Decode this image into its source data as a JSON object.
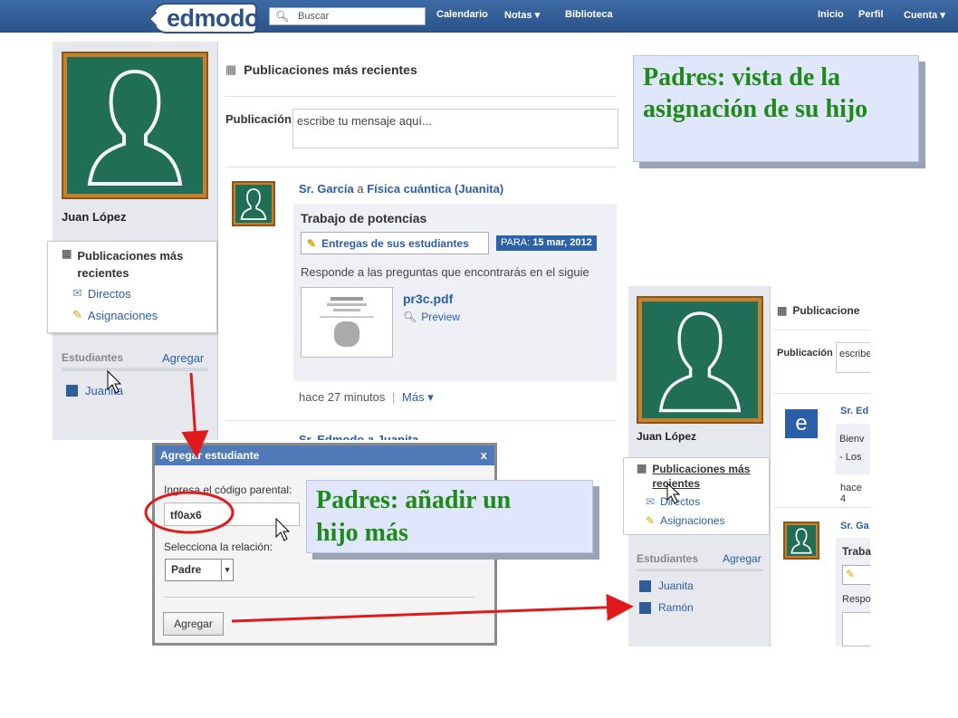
{
  "topbar": {
    "logo": "edmodo",
    "search_placeholder": "Buscar",
    "nav_calendar": "Calendario",
    "nav_notes": "Notas",
    "nav_library": "Biblioteca",
    "nav_home": "Inicio",
    "nav_profile": "Perfil",
    "nav_account": "Cuenta"
  },
  "left": {
    "user_name": "Juan López",
    "menu_recent_1": "Publicaciones más",
    "menu_recent_2": "recientes",
    "menu_direct": "Directos",
    "menu_assign": "Asignaciones",
    "students_label": "Estudiantes",
    "add_label": "Agregar",
    "student_1": "Juanita"
  },
  "feed": {
    "title": "Publicaciones más recientes",
    "post_label": "Publicación",
    "post_placeholder": "escribe tu mensaje aquí...",
    "author": "Sr. García",
    "connector": "a",
    "target": "Física cuántica (Juanita)",
    "assignment_title": "Trabajo de potencias",
    "submissions_btn": "Entregas de sus estudiantes",
    "due_label": "PARA:",
    "due_date": "15 mar, 2012",
    "body": "Responde a las preguntas que encontrarás en el siguie",
    "file_name": "pr3c.pdf",
    "preview": "Preview",
    "time_ago": "hace 27 minutos",
    "sep": "|",
    "more": "Más",
    "next_author": "Sr. Edmodo a Juanita"
  },
  "callout_top": {
    "line1": "Padres: vista de la",
    "line2": "asignación de su hijo"
  },
  "callout_mid": {
    "line1": "Padres: añadir un",
    "line2": "hijo más"
  },
  "dialog": {
    "title": "Agregar estudiante",
    "close": "x",
    "code_label": "Ingresa el código parental:",
    "code_value": "tf0ax6",
    "relation_label": "Selecciona la relación:",
    "relation_value": "Padre",
    "submit": "Agregar"
  },
  "right": {
    "feed_title": "Publicacione",
    "post_label": "Publicación",
    "post_placeholder": "escribe",
    "user_name": "Juan López",
    "menu_recent_1": "Publicaciones más",
    "menu_recent_2": "recientes",
    "menu_direct": "Directos",
    "menu_assign": "Asignaciones",
    "students_label": "Estudiantes",
    "add_label": "Agregar",
    "student_1": "Juanita",
    "student_2": "Ramón",
    "post1_author": "Sr. Ed",
    "post1_line1": "Bienv",
    "post1_line2": "- Los",
    "post1_time": "hace 4",
    "post2_author": "Sr. Ga",
    "post2_title": "Traba",
    "post2_body": "Respo",
    "edmodo_e": "e"
  },
  "colors": {
    "topbar": "#2c5289",
    "link": "#2b5ea8",
    "callout_text": "#1e8a17",
    "arrow": "#e01a1a",
    "board": "#1f6e55",
    "frame": "#c7802e"
  }
}
